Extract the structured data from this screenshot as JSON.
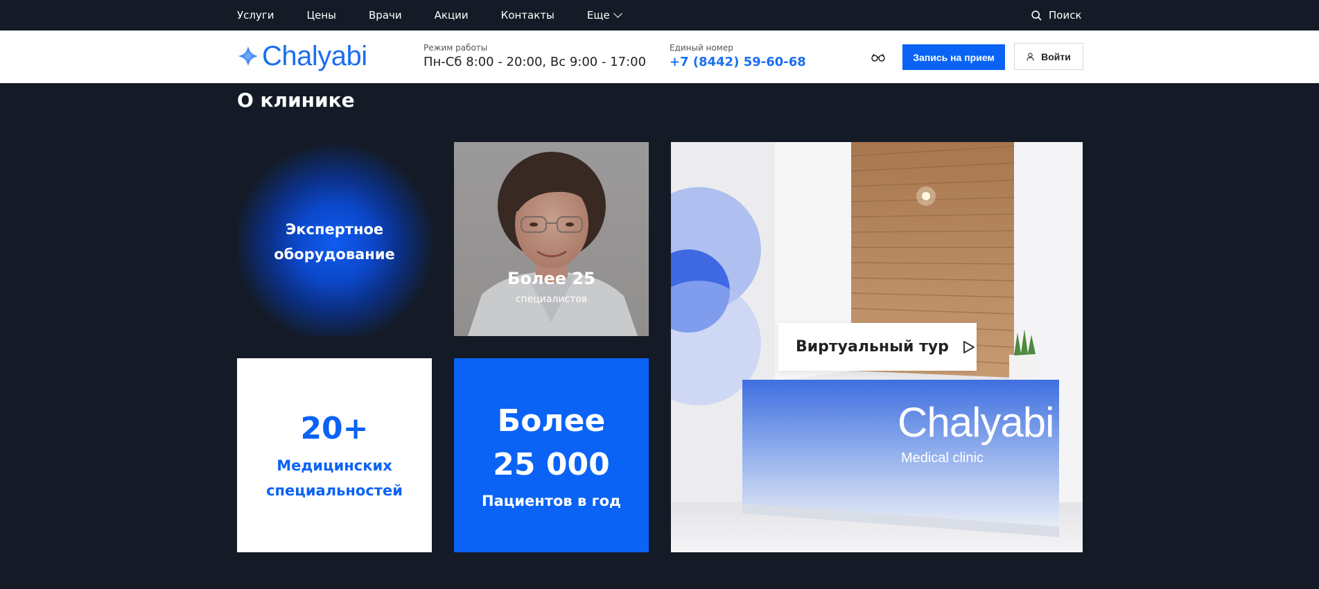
{
  "nav": {
    "items": [
      "Услуги",
      "Цены",
      "Врачи",
      "Акции",
      "Контакты"
    ],
    "more_label": "Еще",
    "search_label": "Поиск"
  },
  "header": {
    "logo_text": "Chalyabi",
    "hours_label": "Режим работы",
    "hours_value": "Пн-Сб 8:00 - 20:00, Вс 9:00 - 17:00",
    "phone_label": "Единый номер",
    "phone_value": "+7 (8442) 59-60-68",
    "appointment_label": "Запись на прием",
    "login_label": "Войти"
  },
  "section": {
    "title": "О клинике"
  },
  "cards": {
    "equipment": {
      "line1": "Экспертное",
      "line2": "оборудование"
    },
    "doctors": {
      "big": "Более 25",
      "small": "специалистов"
    },
    "specialties": {
      "number": "20+",
      "line1": "Медицинских",
      "line2": "специальностей"
    },
    "patients": {
      "line1": "Более",
      "line2": "25 000",
      "line3": "Пациентов в год"
    },
    "tour": {
      "label": "Виртуальный тур",
      "desk_brand": "Chalyabi",
      "desk_sub": "Medical clinic"
    }
  },
  "colors": {
    "accent": "#0a63f5",
    "dark_bg": "#141b26",
    "logo_blue": "#1b6ef0"
  },
  "icons": {
    "search": "search-icon",
    "more": "chevron-down-icon",
    "accessibility": "glasses-icon",
    "login": "user-icon",
    "play": "play-icon"
  }
}
